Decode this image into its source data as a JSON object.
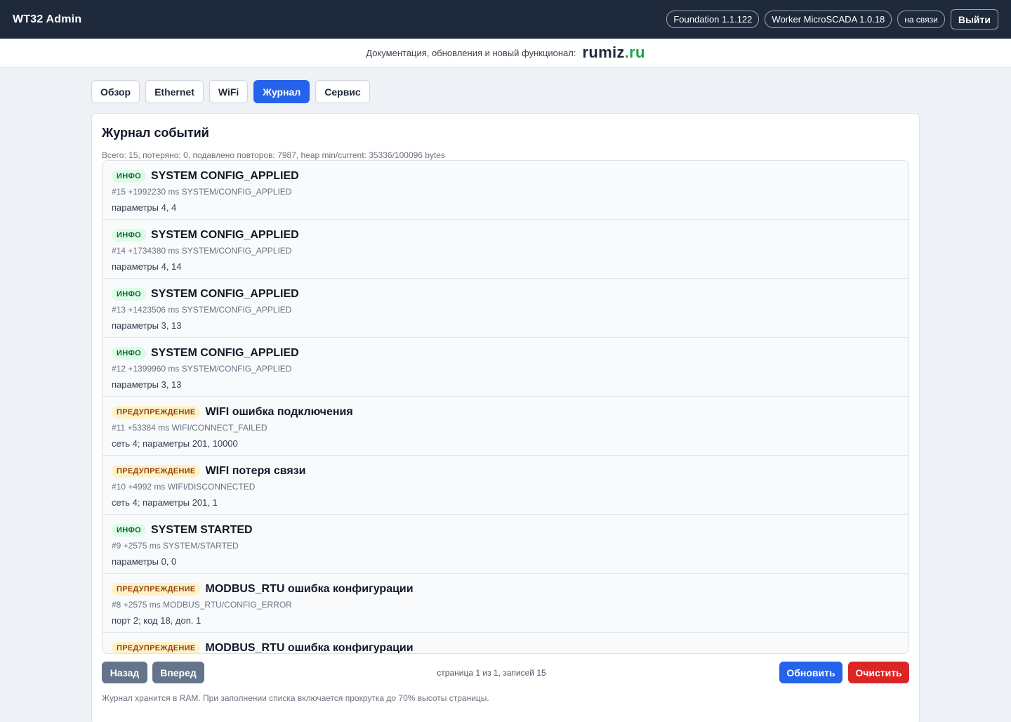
{
  "header": {
    "brand": "WT32 Admin",
    "foundation_version": "Foundation 1.1.122",
    "worker_version": "Worker MicroSCADA 1.0.18",
    "status": "на связи",
    "logout_label": "Выйти"
  },
  "docbar": {
    "text": "Документация, обновления и новый функционал:",
    "logo_part1": "rumiz",
    "logo_part2": ".ru"
  },
  "tabs": [
    {
      "label": "Обзор",
      "active": false
    },
    {
      "label": "Ethernet",
      "active": false
    },
    {
      "label": "WiFi",
      "active": false
    },
    {
      "label": "Журнал",
      "active": true
    },
    {
      "label": "Сервис",
      "active": false
    }
  ],
  "journal": {
    "title": "Журнал событий",
    "stats": "Всего: 15, потеряно: 0, подавлено повторов: 7987, heap min/current: 35336/100096 bytes",
    "entries": [
      {
        "level": "info",
        "badge": "ИНФО",
        "title": "SYSTEM CONFIG_APPLIED",
        "meta": "#15 +1992230 ms SYSTEM/CONFIG_APPLIED",
        "params": "параметры 4, 4"
      },
      {
        "level": "info",
        "badge": "ИНФО",
        "title": "SYSTEM CONFIG_APPLIED",
        "meta": "#14 +1734380 ms SYSTEM/CONFIG_APPLIED",
        "params": "параметры 4, 14"
      },
      {
        "level": "info",
        "badge": "ИНФО",
        "title": "SYSTEM CONFIG_APPLIED",
        "meta": "#13 +1423506 ms SYSTEM/CONFIG_APPLIED",
        "params": "параметры 3, 13"
      },
      {
        "level": "info",
        "badge": "ИНФО",
        "title": "SYSTEM CONFIG_APPLIED",
        "meta": "#12 +1399960 ms SYSTEM/CONFIG_APPLIED",
        "params": "параметры 3, 13"
      },
      {
        "level": "warn",
        "badge": "ПРЕДУПРЕЖДЕНИЕ",
        "title": "WIFI ошибка подключения",
        "meta": "#11 +53384 ms WIFI/CONNECT_FAILED",
        "params": "сеть 4; параметры 201, 10000"
      },
      {
        "level": "warn",
        "badge": "ПРЕДУПРЕЖДЕНИЕ",
        "title": "WIFI потеря связи",
        "meta": "#10 +4992 ms WIFI/DISCONNECTED",
        "params": "сеть 4; параметры 201, 1"
      },
      {
        "level": "info",
        "badge": "ИНФО",
        "title": "SYSTEM STARTED",
        "meta": "#9 +2575 ms SYSTEM/STARTED",
        "params": "параметры 0, 0"
      },
      {
        "level": "warn",
        "badge": "ПРЕДУПРЕЖДЕНИЕ",
        "title": "MODBUS_RTU ошибка конфигурации",
        "meta": "#8 +2575 ms MODBUS_RTU/CONFIG_ERROR",
        "params": "порт 2; код 18, доп. 1"
      },
      {
        "level": "warn",
        "badge": "ПРЕДУПРЕЖДЕНИЕ",
        "title": "MODBUS_RTU ошибка конфигурации",
        "meta": "",
        "params": ""
      }
    ],
    "back_label": "Назад",
    "forward_label": "Вперед",
    "page_info": "страница 1 из 1, записей 15",
    "refresh_label": "Обновить",
    "clear_label": "Очистить",
    "footnote": "Журнал хранится в RAM. При заполнении списка включается прокрутка до 70% высоты страницы."
  }
}
